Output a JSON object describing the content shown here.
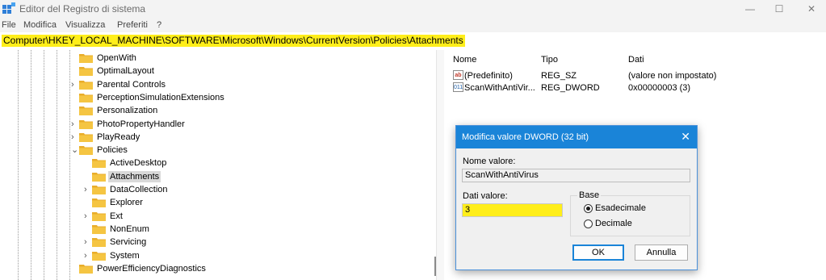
{
  "window": {
    "title": "Editor del Registro di sistema",
    "minimize_glyph": "—",
    "maximize_glyph": "☐",
    "close_glyph": "✕"
  },
  "menu": [
    "File",
    "Modifica",
    "Visualizza",
    "Preferiti",
    "?"
  ],
  "address": "Computer\\HKEY_LOCAL_MACHINE\\SOFTWARE\\Microsoft\\Windows\\CurrentVersion\\Policies\\Attachments",
  "tree": [
    {
      "label": "OpenWith",
      "chevron": ""
    },
    {
      "label": "OptimalLayout",
      "chevron": ""
    },
    {
      "label": "Parental Controls",
      "chevron": "›"
    },
    {
      "label": "PerceptionSimulationExtensions",
      "chevron": ""
    },
    {
      "label": "Personalization",
      "chevron": ""
    },
    {
      "label": "PhotoPropertyHandler",
      "chevron": "›"
    },
    {
      "label": "PlayReady",
      "chevron": "›"
    },
    {
      "label": "Policies",
      "chevron": "⌄"
    },
    {
      "label": "ActiveDesktop",
      "chevron": ""
    },
    {
      "label": "Attachments",
      "chevron": "",
      "selected": true
    },
    {
      "label": "DataCollection",
      "chevron": "›"
    },
    {
      "label": "Explorer",
      "chevron": ""
    },
    {
      "label": "Ext",
      "chevron": "›"
    },
    {
      "label": "NonEnum",
      "chevron": ""
    },
    {
      "label": "Servicing",
      "chevron": "›"
    },
    {
      "label": "System",
      "chevron": "›"
    },
    {
      "label": "PowerEfficiencyDiagnostics",
      "chevron": ""
    }
  ],
  "list": {
    "headers": {
      "name": "Nome",
      "type": "Tipo",
      "data": "Dati"
    },
    "rows": [
      {
        "icon": "ab",
        "name": "(Predefinito)",
        "type": "REG_SZ",
        "data": "(valore non impostato)"
      },
      {
        "icon": "011",
        "name": "ScanWithAntiVir...",
        "type": "REG_DWORD",
        "data": "0x00000003 (3)"
      }
    ]
  },
  "dialog": {
    "title": "Modifica valore DWORD (32 bit)",
    "close_glyph": "✕",
    "name_label": "Nome valore:",
    "name_value": "ScanWithAntiVirus",
    "data_label": "Dati valore:",
    "data_value": "3",
    "base_label": "Base",
    "base_options": [
      "Esadecimale",
      "Decimale"
    ],
    "ok": "OK",
    "cancel": "Annulla"
  },
  "colors": {
    "highlight": "#ffee1a",
    "dialog_title": "#1a84d8",
    "folder": "#f5c542"
  }
}
